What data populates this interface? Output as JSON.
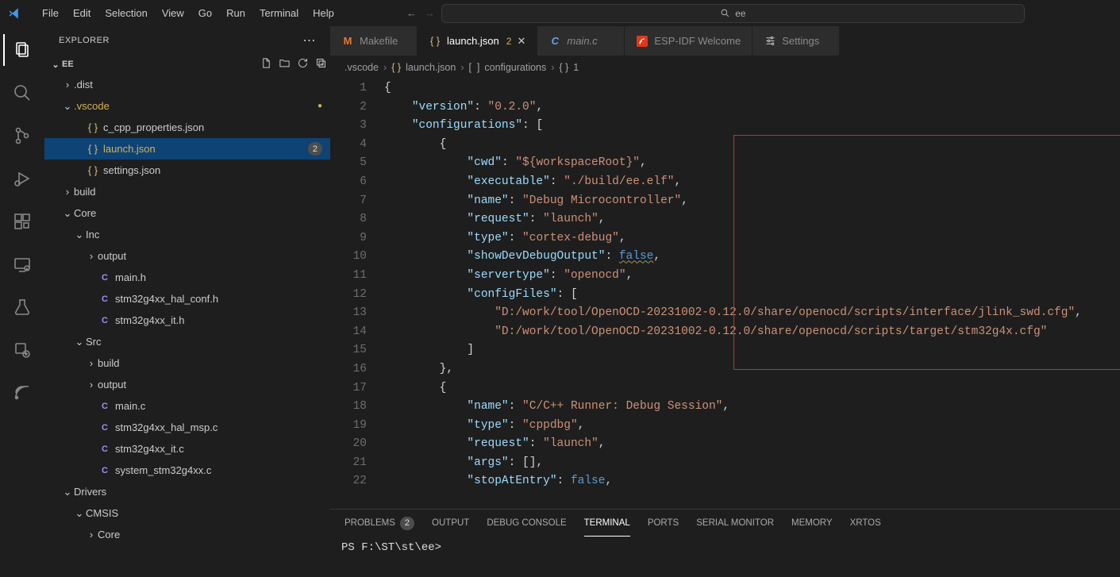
{
  "menubar": {
    "items": [
      "File",
      "Edit",
      "Selection",
      "View",
      "Go",
      "Run",
      "Terminal",
      "Help"
    ],
    "search_label": "ee"
  },
  "activitybar": {
    "items": [
      "explorer",
      "search",
      "source-control",
      "debug",
      "extensions",
      "remote",
      "testing",
      "esp-idf",
      "espressif"
    ]
  },
  "sidebar": {
    "title": "EXPLORER",
    "root": "EE",
    "tree": [
      {
        "type": "folder",
        "name": ".dist",
        "depth": 1,
        "expanded": false
      },
      {
        "type": "folder",
        "name": ".vscode",
        "depth": 1,
        "expanded": true,
        "modified": true,
        "dot": true
      },
      {
        "type": "file",
        "name": "c_cpp_properties.json",
        "depth": 2,
        "icon": "json"
      },
      {
        "type": "file",
        "name": "launch.json",
        "depth": 2,
        "icon": "json",
        "selected": true,
        "modified": true,
        "badge": "2"
      },
      {
        "type": "file",
        "name": "settings.json",
        "depth": 2,
        "icon": "json"
      },
      {
        "type": "folder",
        "name": "build",
        "depth": 1,
        "expanded": false
      },
      {
        "type": "folder",
        "name": "Core",
        "depth": 1,
        "expanded": true
      },
      {
        "type": "folder",
        "name": "Inc",
        "depth": 2,
        "expanded": true
      },
      {
        "type": "folder",
        "name": "output",
        "depth": 3,
        "expanded": false
      },
      {
        "type": "file",
        "name": "main.h",
        "depth": 3,
        "icon": "c"
      },
      {
        "type": "file",
        "name": "stm32g4xx_hal_conf.h",
        "depth": 3,
        "icon": "c"
      },
      {
        "type": "file",
        "name": "stm32g4xx_it.h",
        "depth": 3,
        "icon": "c"
      },
      {
        "type": "folder",
        "name": "Src",
        "depth": 2,
        "expanded": true
      },
      {
        "type": "folder",
        "name": "build",
        "depth": 3,
        "expanded": false
      },
      {
        "type": "folder",
        "name": "output",
        "depth": 3,
        "expanded": false
      },
      {
        "type": "file",
        "name": "main.c",
        "depth": 3,
        "icon": "c"
      },
      {
        "type": "file",
        "name": "stm32g4xx_hal_msp.c",
        "depth": 3,
        "icon": "c"
      },
      {
        "type": "file",
        "name": "stm32g4xx_it.c",
        "depth": 3,
        "icon": "c"
      },
      {
        "type": "file",
        "name": "system_stm32g4xx.c",
        "depth": 3,
        "icon": "c"
      },
      {
        "type": "folder",
        "name": "Drivers",
        "depth": 1,
        "expanded": true
      },
      {
        "type": "folder",
        "name": "CMSIS",
        "depth": 2,
        "expanded": true
      },
      {
        "type": "folder",
        "name": "Core",
        "depth": 3,
        "expanded": false
      }
    ]
  },
  "tabs": [
    {
      "label": "Makefile",
      "icon": "makefile",
      "active": false
    },
    {
      "label": "launch.json",
      "icon": "json",
      "active": true,
      "badge": "2",
      "close": true
    },
    {
      "label": "main.c",
      "icon": "c",
      "active": false,
      "italic": true
    },
    {
      "label": "ESP-IDF Welcome",
      "icon": "esp",
      "active": false
    },
    {
      "label": "Settings",
      "icon": "settings",
      "active": false
    }
  ],
  "breadcrumb": [
    ".vscode",
    "launch.json",
    "configurations",
    "1"
  ],
  "breadcrumb_icons": [
    "",
    "json",
    "array",
    "braces"
  ],
  "code": {
    "lines": [
      {
        "n": 1,
        "html": "<span class='tok-brace'>{</span>"
      },
      {
        "n": 2,
        "html": "    <span class='tok-key'>\"version\"</span><span class='tok-punc'>:</span> <span class='tok-str'>\"0.2.0\"</span><span class='tok-punc'>,</span>"
      },
      {
        "n": 3,
        "html": "    <span class='tok-key'>\"configurations\"</span><span class='tok-punc'>:</span> <span class='tok-brace'>[</span>"
      },
      {
        "n": 4,
        "html": "        <span class='tok-brace'>{</span>"
      },
      {
        "n": 5,
        "html": "            <span class='tok-key'>\"cwd\"</span><span class='tok-punc'>:</span> <span class='tok-str'>\"${workspaceRoot}\"</span><span class='tok-punc'>,</span>"
      },
      {
        "n": 6,
        "html": "            <span class='tok-key'>\"executable\"</span><span class='tok-punc'>:</span> <span class='tok-str'>\"./build/ee.elf\"</span><span class='tok-punc'>,</span>"
      },
      {
        "n": 7,
        "html": "            <span class='tok-key'>\"name\"</span><span class='tok-punc'>:</span> <span class='tok-str'>\"Debug Microcontroller\"</span><span class='tok-punc'>,</span>"
      },
      {
        "n": 8,
        "html": "            <span class='tok-key'>\"request\"</span><span class='tok-punc'>:</span> <span class='tok-str'>\"launch\"</span><span class='tok-punc'>,</span>"
      },
      {
        "n": 9,
        "html": "            <span class='tok-key'>\"type\"</span><span class='tok-punc'>:</span> <span class='tok-str'>\"cortex-debug\"</span><span class='tok-punc'>,</span>"
      },
      {
        "n": 10,
        "html": "            <span class='tok-key'>\"showDevDebugOutput\"</span><span class='tok-punc'>:</span> <span class='tok-bool-underline'>false</span><span class='tok-punc'>,</span>"
      },
      {
        "n": 11,
        "html": "            <span class='tok-key'>\"servertype\"</span><span class='tok-punc'>:</span> <span class='tok-str'>\"openocd\"</span><span class='tok-punc'>,</span>"
      },
      {
        "n": 12,
        "html": "            <span class='tok-key'>\"configFiles\"</span><span class='tok-punc'>:</span> <span class='tok-brace'>[</span>"
      },
      {
        "n": 13,
        "html": "                <span class='tok-str'>\"D:/work/tool/OpenOCD-20231002-0.12.0/share/openocd/scripts/interface/jlink_swd.cfg\"</span><span class='tok-punc'>,</span>"
      },
      {
        "n": 14,
        "html": "                <span class='tok-str'>\"D:/work/tool/OpenOCD-20231002-0.12.0/share/openocd/scripts/target/stm32g4x.cfg\"</span>"
      },
      {
        "n": 15,
        "html": "            <span class='tok-brace'>]</span>"
      },
      {
        "n": 16,
        "html": "        <span class='tok-brace'>}</span><span class='tok-punc'>,</span>"
      },
      {
        "n": 17,
        "html": "        <span class='tok-brace'>{</span>"
      },
      {
        "n": 18,
        "html": "            <span class='tok-key'>\"name\"</span><span class='tok-punc'>:</span> <span class='tok-str'>\"C/C++ Runner: Debug Session\"</span><span class='tok-punc'>,</span>"
      },
      {
        "n": 19,
        "html": "            <span class='tok-key'>\"type\"</span><span class='tok-punc'>:</span> <span class='tok-str'>\"cppdbg\"</span><span class='tok-punc'>,</span>"
      },
      {
        "n": 20,
        "html": "            <span class='tok-key'>\"request\"</span><span class='tok-punc'>:</span> <span class='tok-str'>\"launch\"</span><span class='tok-punc'>,</span>"
      },
      {
        "n": 21,
        "html": "            <span class='tok-key'>\"args\"</span><span class='tok-punc'>:</span> <span class='tok-brace'>[]</span><span class='tok-punc'>,</span>"
      },
      {
        "n": 22,
        "html": "            <span class='tok-key'>\"stopAtEntry\"</span><span class='tok-punc'>:</span> <span class='tok-bool'>false</span><span class='tok-punc'>,</span>"
      }
    ]
  },
  "panel": {
    "tabs": [
      {
        "label": "PROBLEMS",
        "badge": "2"
      },
      {
        "label": "OUTPUT"
      },
      {
        "label": "DEBUG CONSOLE"
      },
      {
        "label": "TERMINAL",
        "active": true
      },
      {
        "label": "PORTS"
      },
      {
        "label": "SERIAL MONITOR"
      },
      {
        "label": "MEMORY"
      },
      {
        "label": "XRTOS"
      }
    ],
    "terminal_line": "PS F:\\ST\\st\\ee>"
  }
}
